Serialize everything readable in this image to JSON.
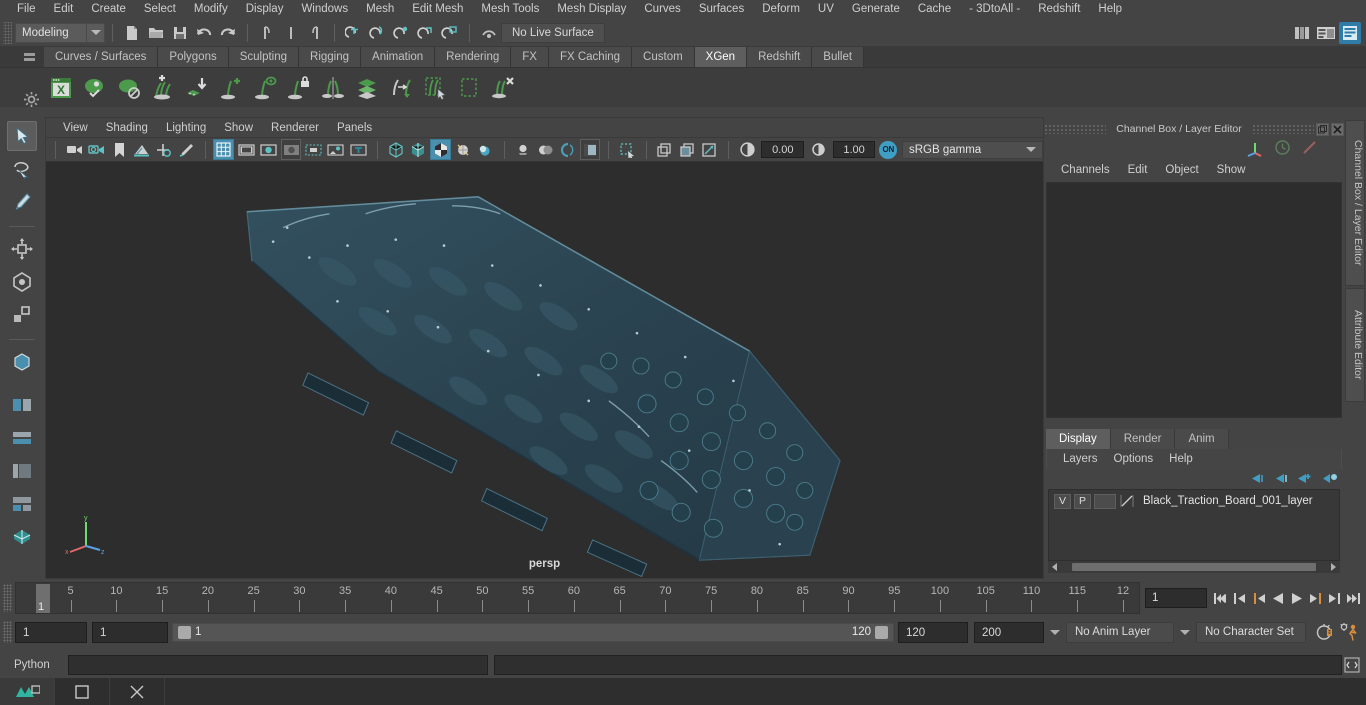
{
  "app": {
    "name": "Autodesk Maya",
    "accent_blue": "#4a8fae",
    "accent_green": "#4c9a4c",
    "bg": "#444444",
    "viewport_bg": "#2d2d2d"
  },
  "menubar": {
    "items": [
      {
        "label": "File"
      },
      {
        "label": "Edit"
      },
      {
        "label": "Create"
      },
      {
        "label": "Select"
      },
      {
        "label": "Modify"
      },
      {
        "label": "Display"
      },
      {
        "label": "Windows"
      },
      {
        "label": "Mesh"
      },
      {
        "label": "Edit Mesh"
      },
      {
        "label": "Mesh Tools"
      },
      {
        "label": "Mesh Display"
      },
      {
        "label": "Curves"
      },
      {
        "label": "Surfaces"
      },
      {
        "label": "Deform"
      },
      {
        "label": "UV"
      },
      {
        "label": "Generate"
      },
      {
        "label": "Cache"
      },
      {
        "label": "- 3DtoAll -"
      },
      {
        "label": "Redshift"
      },
      {
        "label": "Help"
      }
    ]
  },
  "statusline": {
    "menuset": "Modeling",
    "snap_label": "No Live Surface",
    "icons": [
      "new-scene-icon",
      "open-scene-icon",
      "save-scene-icon",
      "undo-icon",
      "redo-icon",
      "select-hierarchy-icon",
      "select-object-icon",
      "select-component-icon",
      "snap-grid-icon",
      "snap-curve-icon",
      "snap-point-icon",
      "snap-projected-icon",
      "snap-view-plane-icon",
      "make-live-icon"
    ]
  },
  "shelf": {
    "tabs": [
      {
        "label": "Curves / Surfaces",
        "active": false
      },
      {
        "label": "Polygons",
        "active": false
      },
      {
        "label": "Sculpting",
        "active": false
      },
      {
        "label": "Rigging",
        "active": false
      },
      {
        "label": "Animation",
        "active": false
      },
      {
        "label": "Rendering",
        "active": false
      },
      {
        "label": "FX",
        "active": false
      },
      {
        "label": "FX Caching",
        "active": false
      },
      {
        "label": "Custom",
        "active": false
      },
      {
        "label": "XGen",
        "active": true
      },
      {
        "label": "Redshift",
        "active": false
      },
      {
        "label": "Bullet",
        "active": false
      }
    ],
    "icons": [
      "xgen-editor-icon",
      "preview-on-icon",
      "preview-off-icon",
      "add-description-icon",
      "import-collection-icon",
      "add-guide-icon",
      "guide-eye-icon",
      "lock-guide-icon",
      "mirror-guide-icon",
      "layers-icon",
      "convert-guide-icon",
      "select-region-icon",
      "clear-region-icon",
      "delete-guide-icon"
    ]
  },
  "toolbox": {
    "items": [
      {
        "name": "select-tool",
        "selected": true
      },
      {
        "name": "lasso-select-tool",
        "selected": false
      },
      {
        "name": "paint-select-tool",
        "selected": false
      },
      {
        "name": "move-tool",
        "selected": false
      },
      {
        "name": "rotate-tool",
        "selected": false
      },
      {
        "name": "scale-tool",
        "selected": false
      },
      {
        "name": "last-tool",
        "selected": false
      },
      {
        "name": "snap-view-icon",
        "selected": false
      },
      {
        "name": "layout-single-icon",
        "selected": false
      },
      {
        "name": "layout-two-pane-icon",
        "selected": false
      },
      {
        "name": "layout-outliner-persp-icon",
        "selected": false
      },
      {
        "name": "layout-hypergraph-icon",
        "selected": false
      },
      {
        "name": "layout-four-view-icon",
        "selected": false
      }
    ]
  },
  "viewport": {
    "menus": [
      {
        "label": "View"
      },
      {
        "label": "Shading"
      },
      {
        "label": "Lighting"
      },
      {
        "label": "Show"
      },
      {
        "label": "Renderer"
      },
      {
        "label": "Panels"
      }
    ],
    "camera_label": "persp",
    "exposure": "0.00",
    "gamma": "1.00",
    "color_management": "sRGB gamma",
    "cm_toggle": "ON",
    "toolbar_icons": [
      "select-camera-icon",
      "camera-attributes-icon",
      "bookmark-icon",
      "image-plane-icon",
      "2d-pan-zoom-icon",
      "grease-pencil-icon",
      "grid-toggle-icon",
      "film-gate-icon",
      "resolution-gate-icon",
      "gate-mask-icon",
      "field-chart-icon",
      "safe-action-icon",
      "safe-title-icon",
      "wireframe-icon",
      "smooth-shade-all-icon",
      "smooth-shade-selected-icon",
      "wireframe-on-shaded-icon",
      "textured-icon",
      "use-all-lights-icon",
      "shadows-icon",
      "screen-space-ao-icon",
      "motion-blur-icon",
      "multisample-aa-icon",
      "isolate-select-icon",
      "xray-icon",
      "xray-joints-icon",
      "xray-active-components-icon",
      "exposure-icon",
      "gamma-icon",
      "color-management-icon"
    ],
    "object_name": "Black_Traction_Board_001",
    "object_color": "#2e4855"
  },
  "channel_box": {
    "panel_title": "Channel Box / Layer Editor",
    "menus": [
      {
        "label": "Channels"
      },
      {
        "label": "Edit"
      },
      {
        "label": "Object"
      },
      {
        "label": "Show"
      }
    ],
    "icons": [
      "axis-gizmo-icon",
      "clock-icon",
      "pen-icon"
    ],
    "window_buttons": [
      "undock-icon",
      "close-icon"
    ],
    "vertical_tabs": [
      {
        "label": "Channel Box / Layer Editor"
      },
      {
        "label": "Attribute Editor"
      }
    ]
  },
  "layer_editor": {
    "tabs": [
      {
        "label": "Display",
        "active": true
      },
      {
        "label": "Render",
        "active": false
      },
      {
        "label": "Anim",
        "active": false
      }
    ],
    "menus": [
      {
        "label": "Layers"
      },
      {
        "label": "Options"
      },
      {
        "label": "Help"
      }
    ],
    "buttons": [
      "prev-layer-icon",
      "next-layer-icon",
      "new-layer-icon",
      "new-layer-from-selected-icon"
    ],
    "layers": [
      {
        "visibility": "V",
        "playback": "P",
        "state": "",
        "name": "Black_Traction_Board_001_layer"
      }
    ]
  },
  "timeline": {
    "current_frame": "1",
    "current_frame_field": "1",
    "ticks": [
      {
        "label": "5",
        "frame": 5
      },
      {
        "label": "10",
        "frame": 10
      },
      {
        "label": "15",
        "frame": 15
      },
      {
        "label": "20",
        "frame": 20
      },
      {
        "label": "25",
        "frame": 25
      },
      {
        "label": "30",
        "frame": 30
      },
      {
        "label": "35",
        "frame": 35
      },
      {
        "label": "40",
        "frame": 40
      },
      {
        "label": "45",
        "frame": 45
      },
      {
        "label": "50",
        "frame": 50
      },
      {
        "label": "55",
        "frame": 55
      },
      {
        "label": "60",
        "frame": 60
      },
      {
        "label": "65",
        "frame": 65
      },
      {
        "label": "70",
        "frame": 70
      },
      {
        "label": "75",
        "frame": 75
      },
      {
        "label": "80",
        "frame": 80
      },
      {
        "label": "85",
        "frame": 85
      },
      {
        "label": "90",
        "frame": 90
      },
      {
        "label": "95",
        "frame": 95
      },
      {
        "label": "100",
        "frame": 100
      },
      {
        "label": "105",
        "frame": 105
      },
      {
        "label": "110",
        "frame": 110
      },
      {
        "label": "115",
        "frame": 115
      },
      {
        "label": "12",
        "frame": 120
      }
    ],
    "range_start": 1,
    "range_end": 120,
    "playback_buttons": [
      "go-to-start-icon",
      "step-back-keyframe-icon",
      "step-back-frame-icon",
      "play-backwards-icon",
      "play-forwards-icon",
      "step-forward-frame-icon",
      "step-forward-keyframe-icon",
      "go-to-end-icon"
    ]
  },
  "range_slider": {
    "anim_start": "1",
    "range_start": "1",
    "bar_start_label": "1",
    "bar_end_label": "120",
    "range_end": "120",
    "anim_end": "200",
    "anim_layer": "No Anim Layer",
    "character_set": "No Character Set",
    "icons": [
      "auto-key-icon",
      "animation-preferences-icon"
    ]
  },
  "command_line": {
    "language": "Python",
    "input_value": "",
    "result_value": "",
    "script_editor_icon": "script-editor-icon"
  },
  "taskbar": {
    "items": [
      "maya-app-icon",
      "window-icon",
      "close-icon"
    ]
  }
}
